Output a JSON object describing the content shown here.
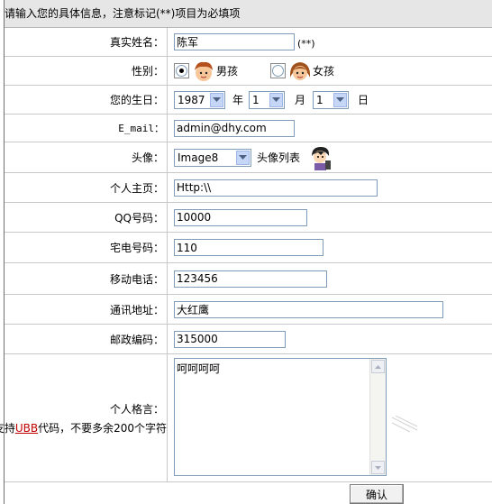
{
  "header": {
    "text": "请输入您的具体信息，注意标记(**)项目为必填项"
  },
  "fields": {
    "name": {
      "label": "真实姓名：",
      "value": "陈军",
      "required_mark": "(**)"
    },
    "gender": {
      "label": "性别：",
      "options": [
        "男孩",
        "女孩"
      ],
      "selected": "男孩"
    },
    "birthday": {
      "label": "您的生日：",
      "year": "1987",
      "year_unit": "年",
      "month": "1",
      "month_unit": "月",
      "day": "1",
      "day_unit": "日"
    },
    "email": {
      "label": "E_mail：",
      "value": "admin@dhy.com"
    },
    "avatar": {
      "label": "头像：",
      "value": "Image8",
      "list_label": "头像列表"
    },
    "homepage": {
      "label": "个人主页：",
      "value": "Http:\\\\"
    },
    "qq": {
      "label": "QQ号码：",
      "value": "10000"
    },
    "phone": {
      "label": "宅电号码：",
      "value": "110"
    },
    "mobile": {
      "label": "移动电话：",
      "value": "123456"
    },
    "address": {
      "label": "通讯地址：",
      "value": "大红鹰"
    },
    "zip": {
      "label": "邮政编码：",
      "value": "315000"
    },
    "signature": {
      "label": "个人格言：",
      "note_prefix": "支持",
      "note_ubb": "UBB",
      "note_suffix": "代码，不要多余200个字符",
      "value": "呵呵呵呵"
    }
  },
  "buttons": {
    "confirm": "确认"
  },
  "colors": {
    "header_bg": "#e6e6e6",
    "border": "#c8c8c8",
    "input_border": "#7f9db9",
    "link_red": "#c00000"
  }
}
